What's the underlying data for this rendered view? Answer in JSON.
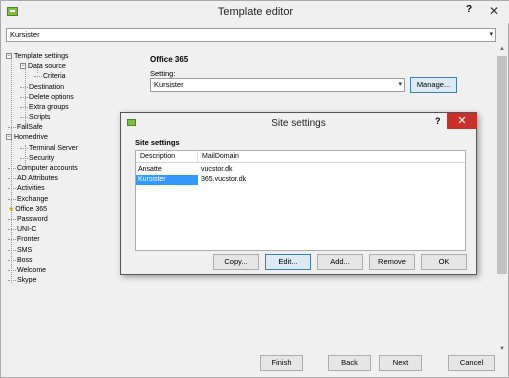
{
  "window": {
    "title": "Template editor",
    "help": "?",
    "close": "✕",
    "template_combo": "Kursister"
  },
  "tree": {
    "items": [
      {
        "label": "Template settings",
        "expander": "−"
      },
      {
        "label": "Data source",
        "expander": "−"
      },
      {
        "label": "Criteria"
      },
      {
        "label": "Destination"
      },
      {
        "label": "Delete options"
      },
      {
        "label": "Extra groups"
      },
      {
        "label": "Scripts"
      },
      {
        "label": "FailSafe"
      },
      {
        "label": "Homedrive",
        "expander": "−"
      },
      {
        "label": "Terminal Server"
      },
      {
        "label": "Security"
      },
      {
        "label": "Computer accounts"
      },
      {
        "label": "AD Attributes"
      },
      {
        "label": "Activities"
      },
      {
        "label": "Exchange"
      },
      {
        "label": "Office 365",
        "marker": "★"
      },
      {
        "label": "Password"
      },
      {
        "label": "UNI-C"
      },
      {
        "label": "Fronter"
      },
      {
        "label": "SMS"
      },
      {
        "label": "Boss"
      },
      {
        "label": "Welcome"
      },
      {
        "label": "Skype"
      }
    ]
  },
  "panel": {
    "title": "Office 365",
    "setting_label": "Setting:",
    "setting_value": "Kursister",
    "manage_button": "Manage..."
  },
  "dialog": {
    "title": "Site settings",
    "help": "?",
    "close": "✕",
    "section": "Site settings",
    "columns": [
      "Description",
      "MailDomain"
    ],
    "rows": [
      {
        "description": "Ansatte",
        "maildomain": "vucstor.dk",
        "selected": false
      },
      {
        "description": "Kursister",
        "maildomain": "365.vucstor.dk",
        "selected": true
      }
    ],
    "buttons": {
      "copy": "Copy...",
      "edit": "Edit...",
      "add": "Add...",
      "remove": "Remove",
      "ok": "OK"
    }
  },
  "footer": {
    "finish": "Finish",
    "back": "Back",
    "next": "Next",
    "cancel": "Cancel"
  },
  "icons": {
    "combo_arrow": "▾",
    "scroll_up": "▲",
    "scroll_down": "▼"
  }
}
